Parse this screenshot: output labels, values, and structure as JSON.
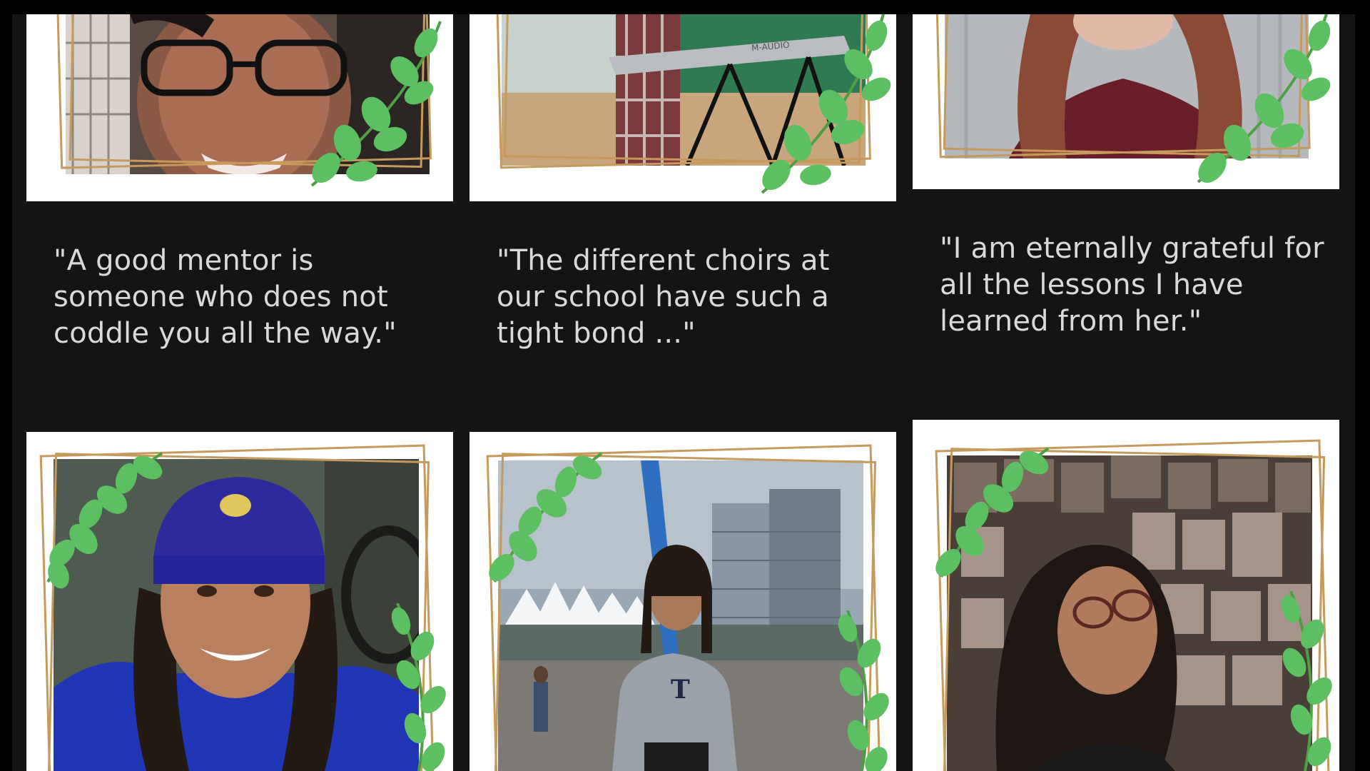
{
  "quotes": [
    {
      "lines": [
        "\"A good mentor is",
        "someone who does not",
        "coddle you all the way.\""
      ]
    },
    {
      "lines": [
        "\"The different choirs at",
        "our school have such a",
        "tight bond ...\""
      ]
    },
    {
      "lines": [
        "\"I am eternally grateful for",
        "all the lessons I have",
        "learned from her.\""
      ]
    }
  ],
  "photos": [
    {
      "name": "student-photo-glasses",
      "keyboard_brand": ""
    },
    {
      "name": "student-photo-keyboard",
      "keyboard_brand": "M-AUDIO"
    },
    {
      "name": "student-photo-red-sweater"
    },
    {
      "name": "student-photo-blue-beanie"
    },
    {
      "name": "student-photo-waterfront",
      "hoodie_letter": "T"
    },
    {
      "name": "student-photo-collage-wall"
    }
  ],
  "colors": {
    "background": "#141414",
    "card": "#ffffff",
    "frame": "#c59a5c",
    "leaf": "#5cbf62",
    "quote_text": "#d9d9d9"
  }
}
